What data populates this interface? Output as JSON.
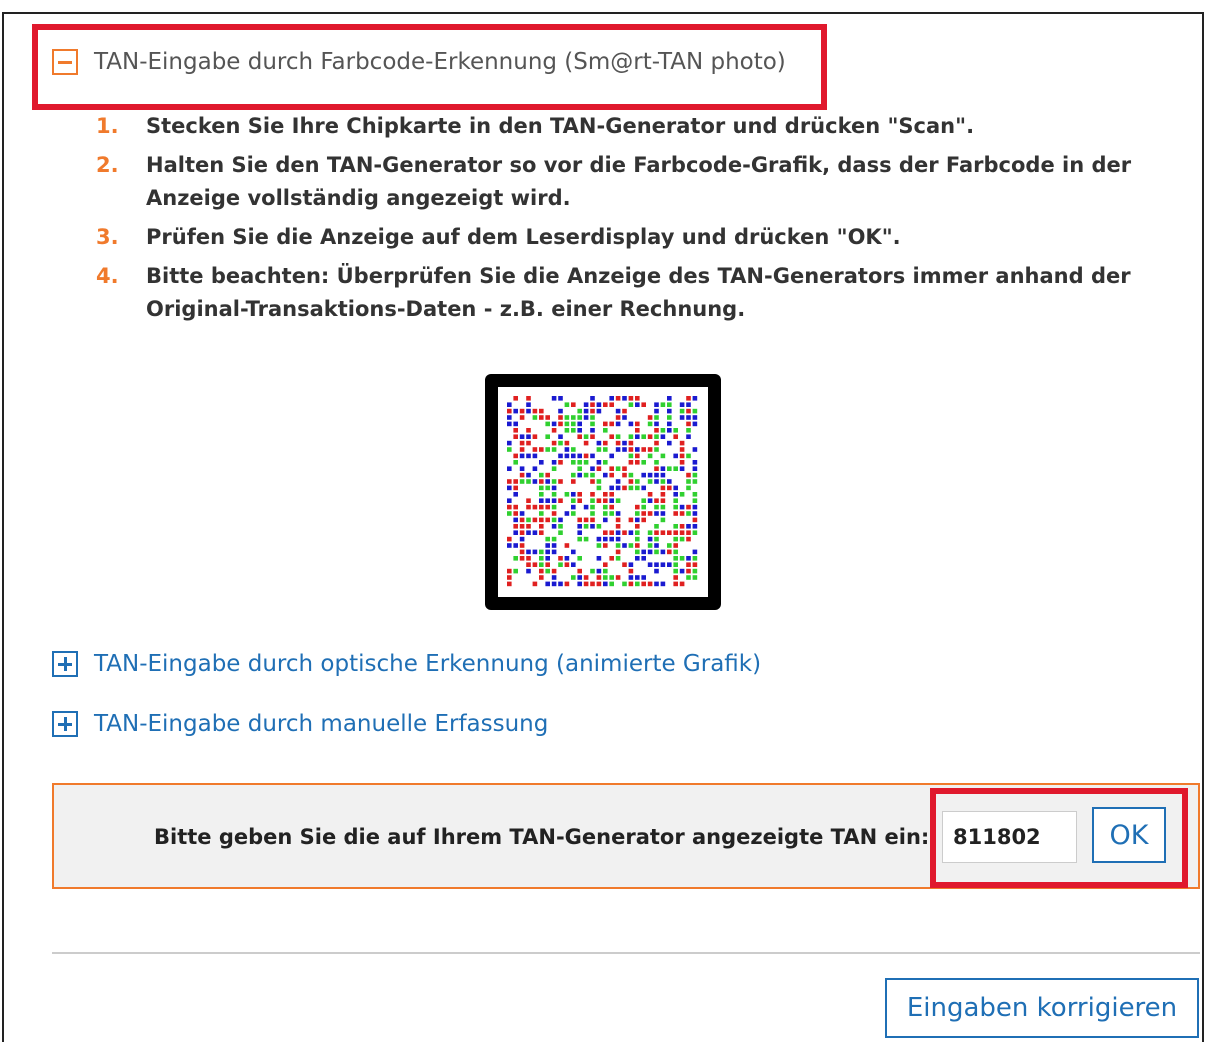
{
  "sections": {
    "photo": {
      "label": "TAN-Eingabe durch Farbcode-Erkennung (Sm@rt-TAN photo)",
      "state": "expanded",
      "icon": "minus-icon"
    },
    "optical": {
      "label": "TAN-Eingabe durch optische Erkennung (animierte Grafik)",
      "state": "collapsed",
      "icon": "plus-icon"
    },
    "manual": {
      "label": "TAN-Eingabe durch manuelle Erfassung",
      "state": "collapsed",
      "icon": "plus-icon"
    }
  },
  "steps": [
    {
      "num": "1.",
      "text": "Stecken Sie Ihre Chipkarte in den TAN-Generator und drücken \"Scan\"."
    },
    {
      "num": "2.",
      "text": "Halten Sie den TAN-Generator so vor die Farbcode-Grafik, dass der Farbcode in der Anzeige vollständig angezeigt wird."
    },
    {
      "num": "3.",
      "text": "Prüfen Sie die Anzeige auf dem Leserdisplay und drücken \"OK\"."
    },
    {
      "num": "4.",
      "text": "Bitte beachten: Überprüfen Sie die Anzeige des TAN-Generators immer anhand der Original-Transaktions-Daten - z.B. einer Rechnung."
    }
  ],
  "tan": {
    "label": "Bitte geben Sie die auf Ihrem TAN-Generator angezeigte TAN ein:",
    "value": "811802",
    "ok_label": "OK"
  },
  "footer": {
    "correct_label": "Eingaben korrigieren"
  },
  "colors": {
    "accent_orange": "#f07a2c",
    "link_blue": "#1f6fb5",
    "highlight_red": "#e0192d",
    "code_red": "#e02020",
    "code_green": "#30d030",
    "code_blue": "#1a1ad0"
  }
}
